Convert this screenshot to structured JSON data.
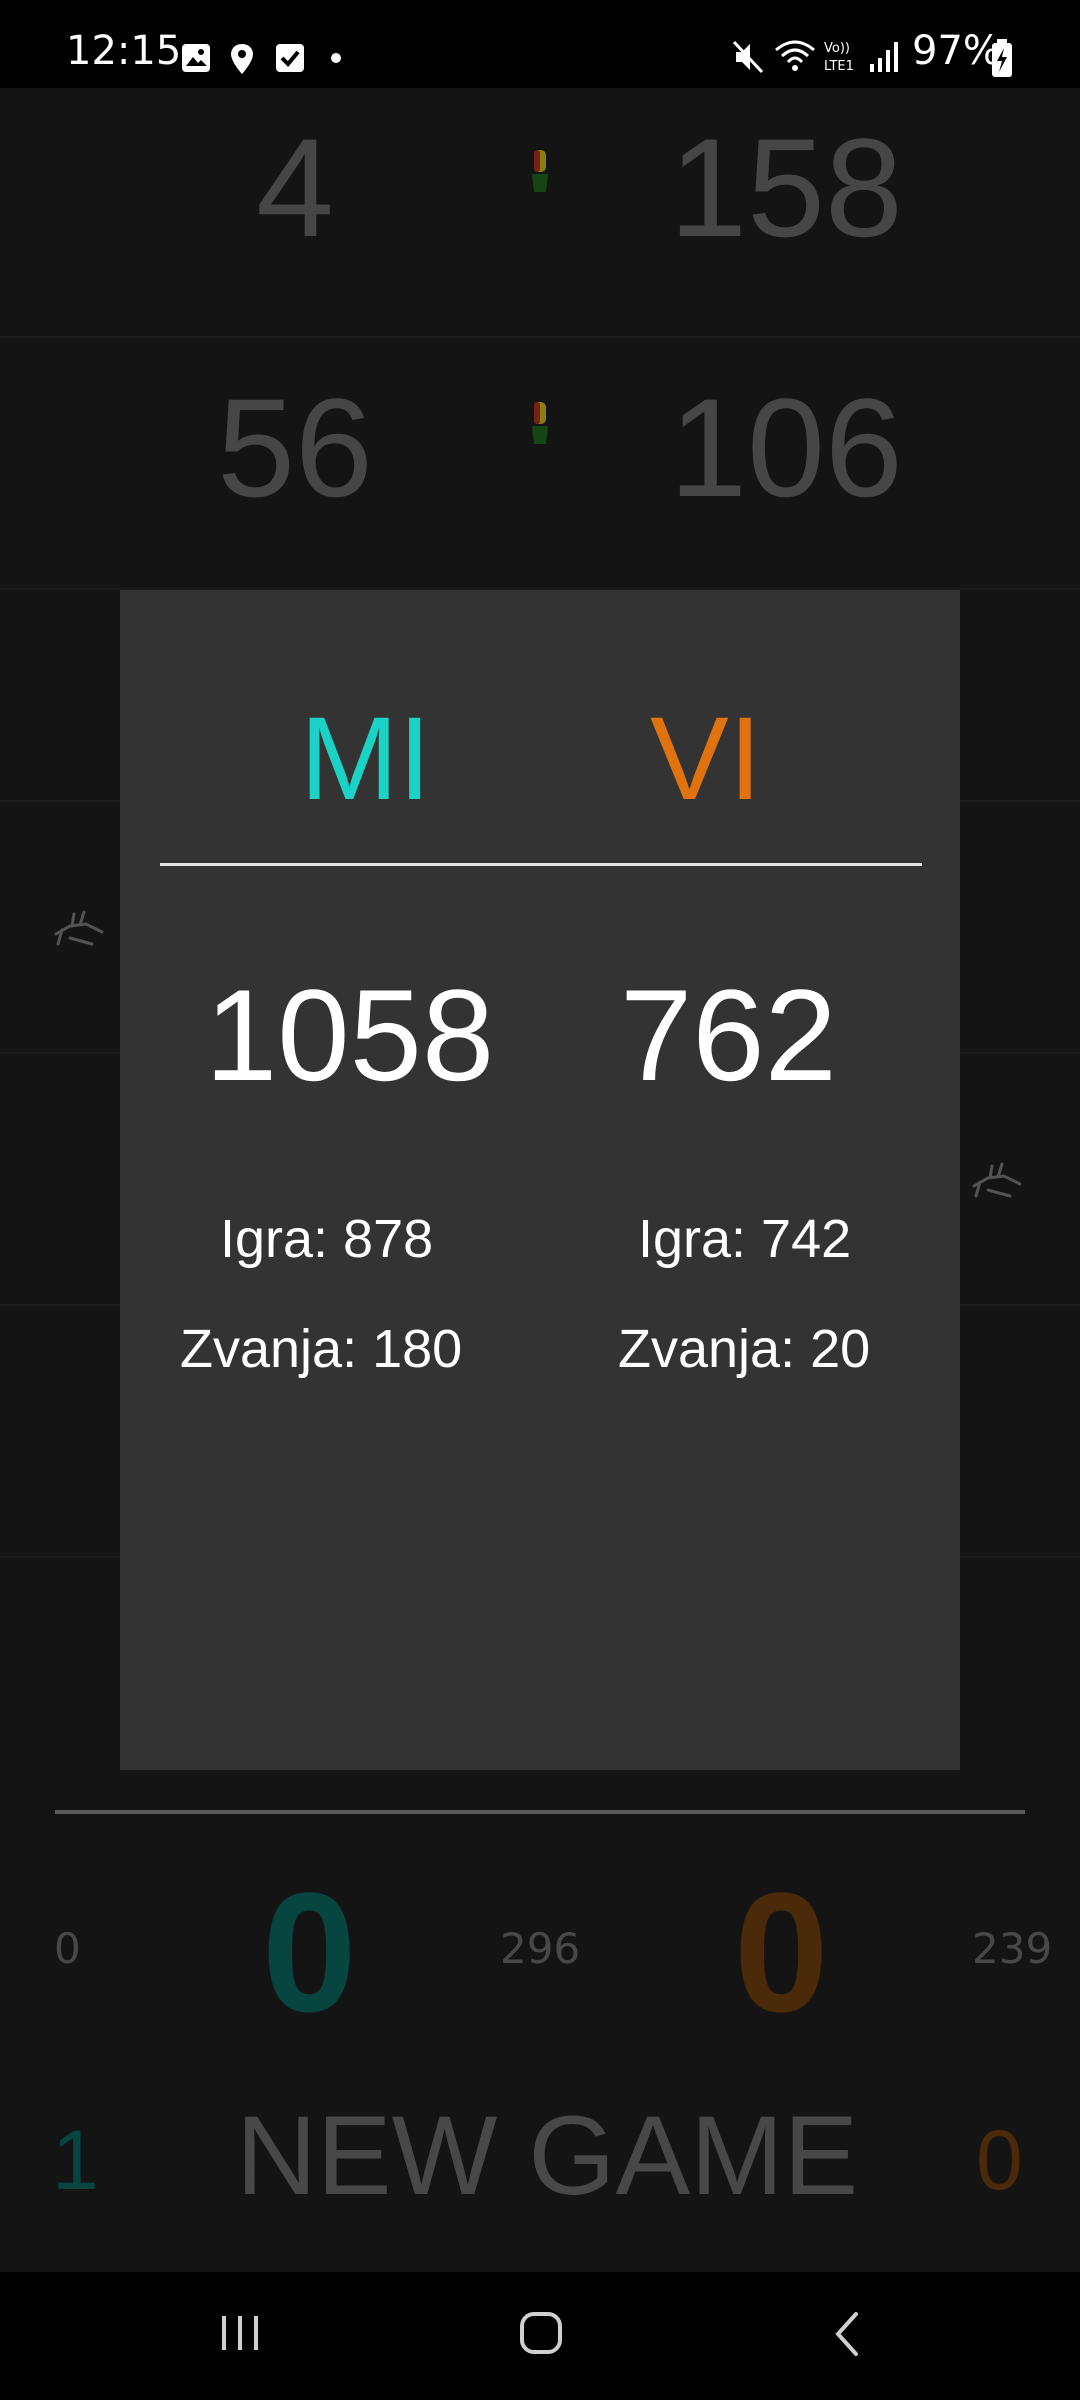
{
  "status_bar": {
    "time": "12:15",
    "battery": "97%"
  },
  "rows": [
    {
      "left": "4",
      "right": "158"
    },
    {
      "left": "56",
      "right": "106"
    }
  ],
  "dialog": {
    "team_left": "MI",
    "team_right": "VI",
    "total_left": "1058",
    "total_right": "762",
    "igra_left": "Igra: 878",
    "igra_right": "Igra: 742",
    "zvanja_left": "Zvanja: 180",
    "zvanja_right": "Zvanja: 20"
  },
  "bottom": {
    "left_small": "0",
    "left_big": "0",
    "middle_small": "296",
    "right_big": "0",
    "right_small": "239",
    "new_game_label": "NEW GAME",
    "games_left": "1",
    "games_right": "0"
  },
  "colors": {
    "mi": "#1ad3c6",
    "vi": "#e1730f"
  }
}
